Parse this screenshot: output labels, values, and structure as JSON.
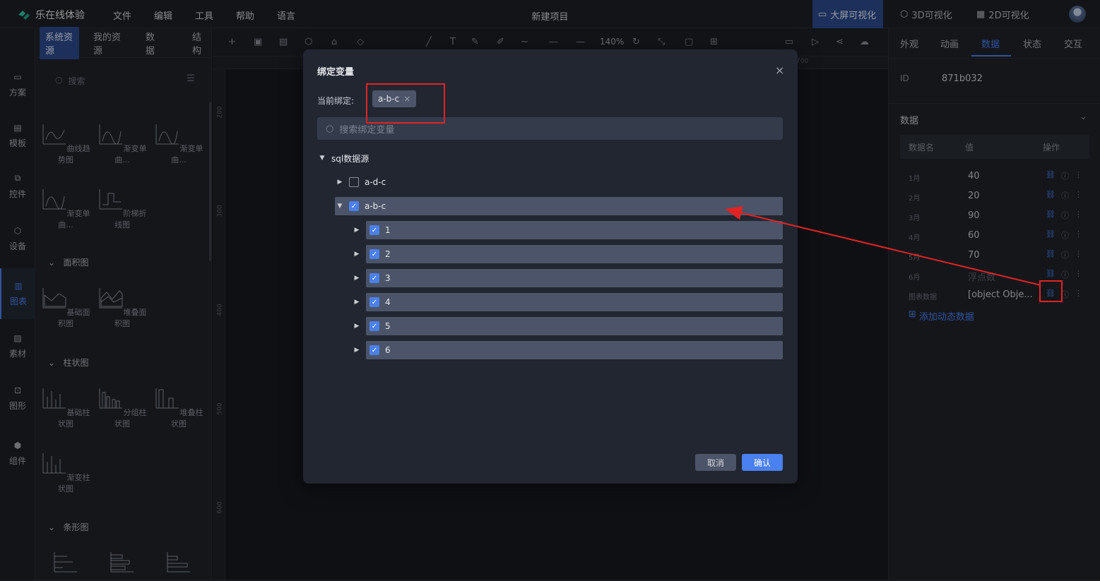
{
  "topbar": {
    "logo_text": "乐在线体验",
    "menus": [
      "文件",
      "编辑",
      "工具",
      "帮助",
      "语言"
    ],
    "project_title": "新建项目",
    "view_tabs": [
      "大屏可视化",
      "3D可视化",
      "2D可视化"
    ]
  },
  "rail": [
    "方案",
    "模板",
    "控件",
    "设备",
    "图表",
    "素材",
    "图形",
    "组件"
  ],
  "left_panel": {
    "tabs": [
      "系统资源",
      "我的资源",
      "数据",
      "结构"
    ],
    "search_placeholder": "搜索",
    "line_items": [
      "曲线趋势图",
      "渐变单曲...",
      "渐变单曲...",
      "渐变单曲...",
      "阶梯折线图"
    ],
    "sections": [
      "面积图",
      "柱状图",
      "条形图"
    ],
    "area_items": [
      "基础面积图",
      "堆叠面积图"
    ],
    "bar_items": [
      "基础柱状图",
      "分组柱状图",
      "堆叠柱状图",
      "渐变柱状图"
    ]
  },
  "toolbar": {
    "zoom": "140%",
    "ruler_h": "700",
    "ruler_v": [
      "200",
      "300",
      "400",
      "500",
      "600"
    ]
  },
  "right_panel": {
    "tabs": [
      "外观",
      "动画",
      "数据",
      "状态",
      "交互"
    ],
    "id_label": "ID",
    "id_value": "871b032",
    "section_title": "数据",
    "col_name": "数据名",
    "col_value": "值",
    "col_ops": "操作",
    "rows": [
      {
        "name": "1月",
        "value": "40"
      },
      {
        "name": "2月",
        "value": "20"
      },
      {
        "name": "3月",
        "value": "90"
      },
      {
        "name": "4月",
        "value": "60"
      },
      {
        "name": "5月",
        "value": "70"
      },
      {
        "name": "6月",
        "value": "浮点数"
      },
      {
        "name": "图表数据",
        "value": "[object Obje..."
      }
    ],
    "add_dynamic": "添加动态数据"
  },
  "modal": {
    "title": "绑定变量",
    "current_label": "当前绑定:",
    "current_tag": "a-b-c",
    "search_placeholder": "搜索绑定变量",
    "tree_root": "sql数据源",
    "node_adc": "a-d-c",
    "node_abc": "a-b-c",
    "children": [
      "1",
      "2",
      "3",
      "4",
      "5",
      "6"
    ],
    "cancel": "取消",
    "confirm": "确认"
  },
  "colors": {
    "accent": "#4a80f0",
    "annotation": "#e02424",
    "selected_row": "#4b5468"
  }
}
